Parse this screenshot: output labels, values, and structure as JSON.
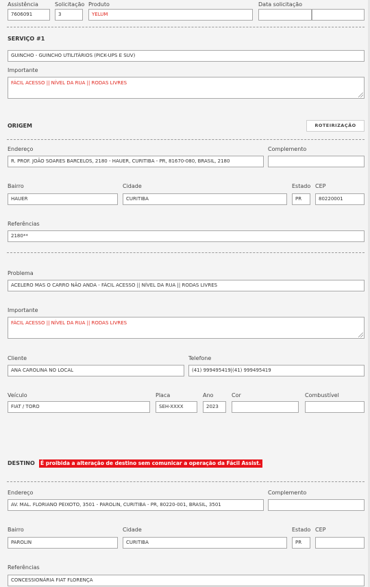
{
  "header": {
    "assistencia_label": "Assistência",
    "assistencia_value": "7606091",
    "solicitacao_label": "Solicitação",
    "solicitacao_value": "3",
    "produto_label": "Produto",
    "produto_value": "YELUM",
    "data_label": "Data solicitação",
    "data_value": "",
    "hora_value": ""
  },
  "servico": {
    "title": "SERVIÇO #1",
    "tipo_value": "GUINCHO - GUINCHO UTILITÁRIOS (PICK-UPS E SUV)",
    "importante_label": "Importante",
    "importante_value": "FÁCIL ACESSO || NÍVEL DA RUA || RODAS LIVRES"
  },
  "origem": {
    "title": "ORIGEM",
    "roteirizacao_label": "ROTEIRIZAÇÃO",
    "endereco_label": "Endereço",
    "endereco_value": "R. PROF. JOÃO SOARES BARCELOS, 2180 - HAUER, CURITIBA - PR, 81670-080, BRASIL, 2180",
    "complemento_label": "Complemento",
    "complemento_value": "",
    "bairro_label": "Bairro",
    "bairro_value": "HAUER",
    "cidade_label": "Cidade",
    "cidade_value": "CURITIBA",
    "estado_label": "Estado",
    "estado_value": "PR",
    "cep_label": "CEP",
    "cep_value": "80220001",
    "referencias_label": "Referências",
    "referencias_value": "2180**"
  },
  "problema": {
    "problema_label": "Problema",
    "problema_value": "ACELERO MAS O CARRO NÃO ANDA - FÁCIL ACESSO || NÍVEL DA RUA || RODAS LIVRES",
    "importante_label": "Importante",
    "importante_value": "FÁCIL ACESSO || NÍVEL DA RUA || RODAS LIVRES",
    "cliente_label": "Cliente",
    "cliente_value": "ANA CAROLINA NO LOCAL",
    "telefone_label": "Telefone",
    "telefone_value": "(41) 999495419|(41) 999495419",
    "veiculo_label": "Veículo",
    "veiculo_value": "FIAT / TORO",
    "placa_label": "Placa",
    "placa_value": "SEH-XXXX",
    "ano_label": "Ano",
    "ano_value": "2023",
    "cor_label": "Cor",
    "cor_value": "",
    "combustivel_label": "Combustível",
    "combustivel_value": ""
  },
  "destino": {
    "title": "DESTINO",
    "warning": "É proibida a alteração de destino sem comunicar a operação da Fácil Assist.",
    "endereco_label": "Endereço",
    "endereco_value": "AV. MAL. FLORIANO PEIXOTO, 3501 - PAROLIN, CURITIBA - PR, 80220-001, BRASIL, 3501",
    "complemento_label": "Complemento",
    "complemento_value": "",
    "bairro_label": "Bairro",
    "bairro_value": "PAROLIN",
    "cidade_label": "Cidade",
    "cidade_value": "CURITIBA",
    "estado_label": "Estado",
    "estado_value": "PR",
    "cep_label": "CEP",
    "cep_value": "",
    "referencias_label": "Referências",
    "referencias_value": "CONCESSIONÁRIA FIAT FLORENÇA"
  }
}
